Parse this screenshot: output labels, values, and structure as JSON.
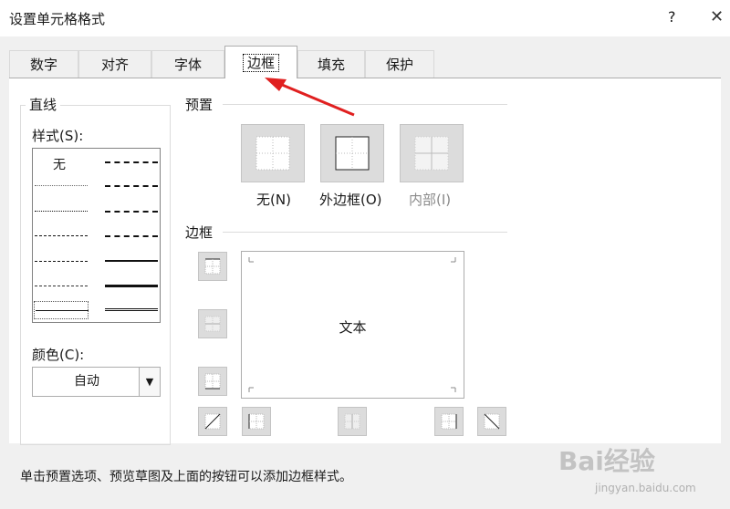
{
  "window": {
    "title": "设置单元格格式",
    "help_label": "?",
    "close_label": "✕"
  },
  "tabs": [
    {
      "label": "数字"
    },
    {
      "label": "对齐"
    },
    {
      "label": "字体"
    },
    {
      "label": "边框"
    },
    {
      "label": "填充"
    },
    {
      "label": "保护"
    }
  ],
  "line_group": {
    "title": "直线",
    "style_label": "样式(S):",
    "none_label": "无",
    "color_label": "颜色(C):",
    "color_value": "自动"
  },
  "presets": {
    "title": "预置",
    "none_label": "无(N)",
    "outline_label": "外边框(O)",
    "inside_label": "内部(I)"
  },
  "border": {
    "title": "边框",
    "preview_text": "文本"
  },
  "hint": "单击预置选项、预览草图及上面的按钮可以添加边框样式。",
  "watermark": {
    "brand": "Bai经验",
    "url": "jingyan.baidu.com"
  },
  "colors": {
    "arrow": "#e02020",
    "tab_active_bg": "#ffffff",
    "dialog_bg": "#f0f0f0"
  }
}
